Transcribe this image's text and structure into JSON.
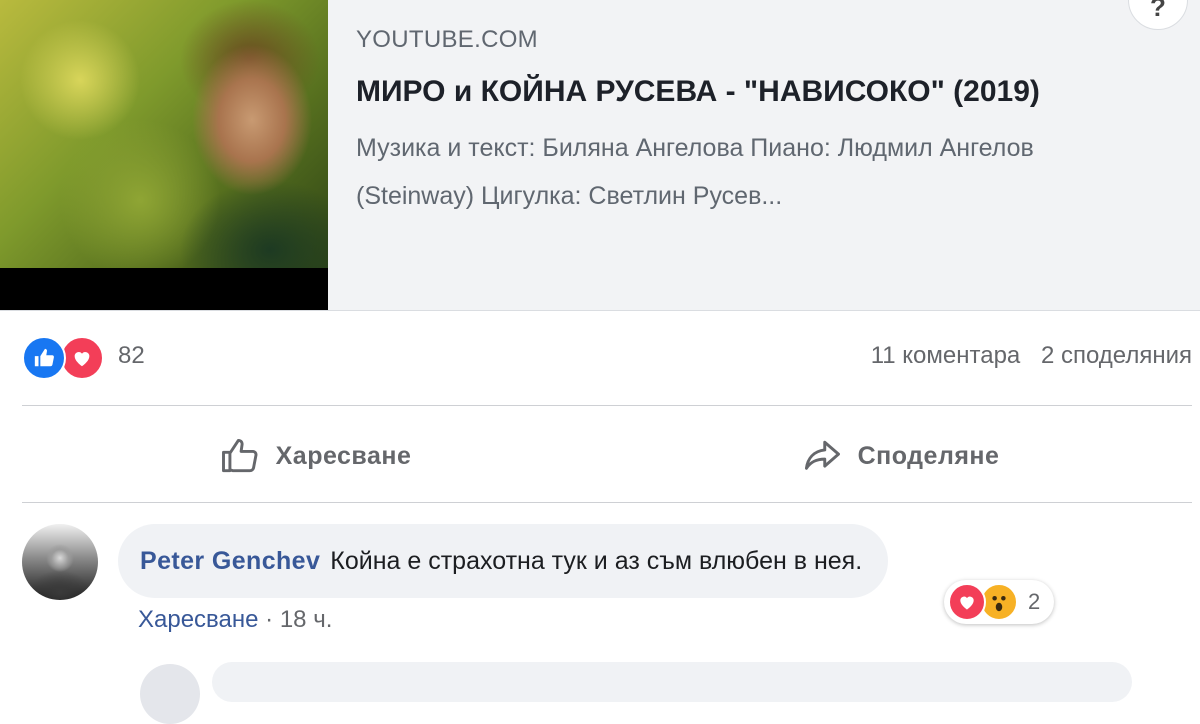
{
  "link_preview": {
    "source": "YOUTUBE.COM",
    "title": "МИРО и КОЙНА РУСЕВА - \"НАВИСОКО\" (2019)",
    "description": "Музика и текст: Биляна Ангелова Пиано: Людмил Ангелов (Steinway) Цигулка: Светлин Русев...",
    "more_label": "?"
  },
  "reactions": {
    "count": "82",
    "types": [
      "like-icon",
      "love-icon"
    ]
  },
  "stats": {
    "comments": "11 коментара",
    "shares": "2 споделяния"
  },
  "actions": {
    "like_label": "Харесване",
    "share_label": "Споделяне"
  },
  "comment": {
    "author": "Peter Genchev",
    "text": "Койна е страхотна тук и аз съм влюбен в нея.",
    "like_label": "Харесване",
    "separator": "·",
    "time": "18 ч.",
    "reaction_count": "2",
    "reaction_types": [
      "love-icon",
      "wow-icon"
    ]
  },
  "colors": {
    "link_blue": "#385898",
    "like_blue": "#1877f2",
    "love_red": "#f33e58",
    "wow_yellow": "#f7b125",
    "muted_text": "#65676b"
  }
}
